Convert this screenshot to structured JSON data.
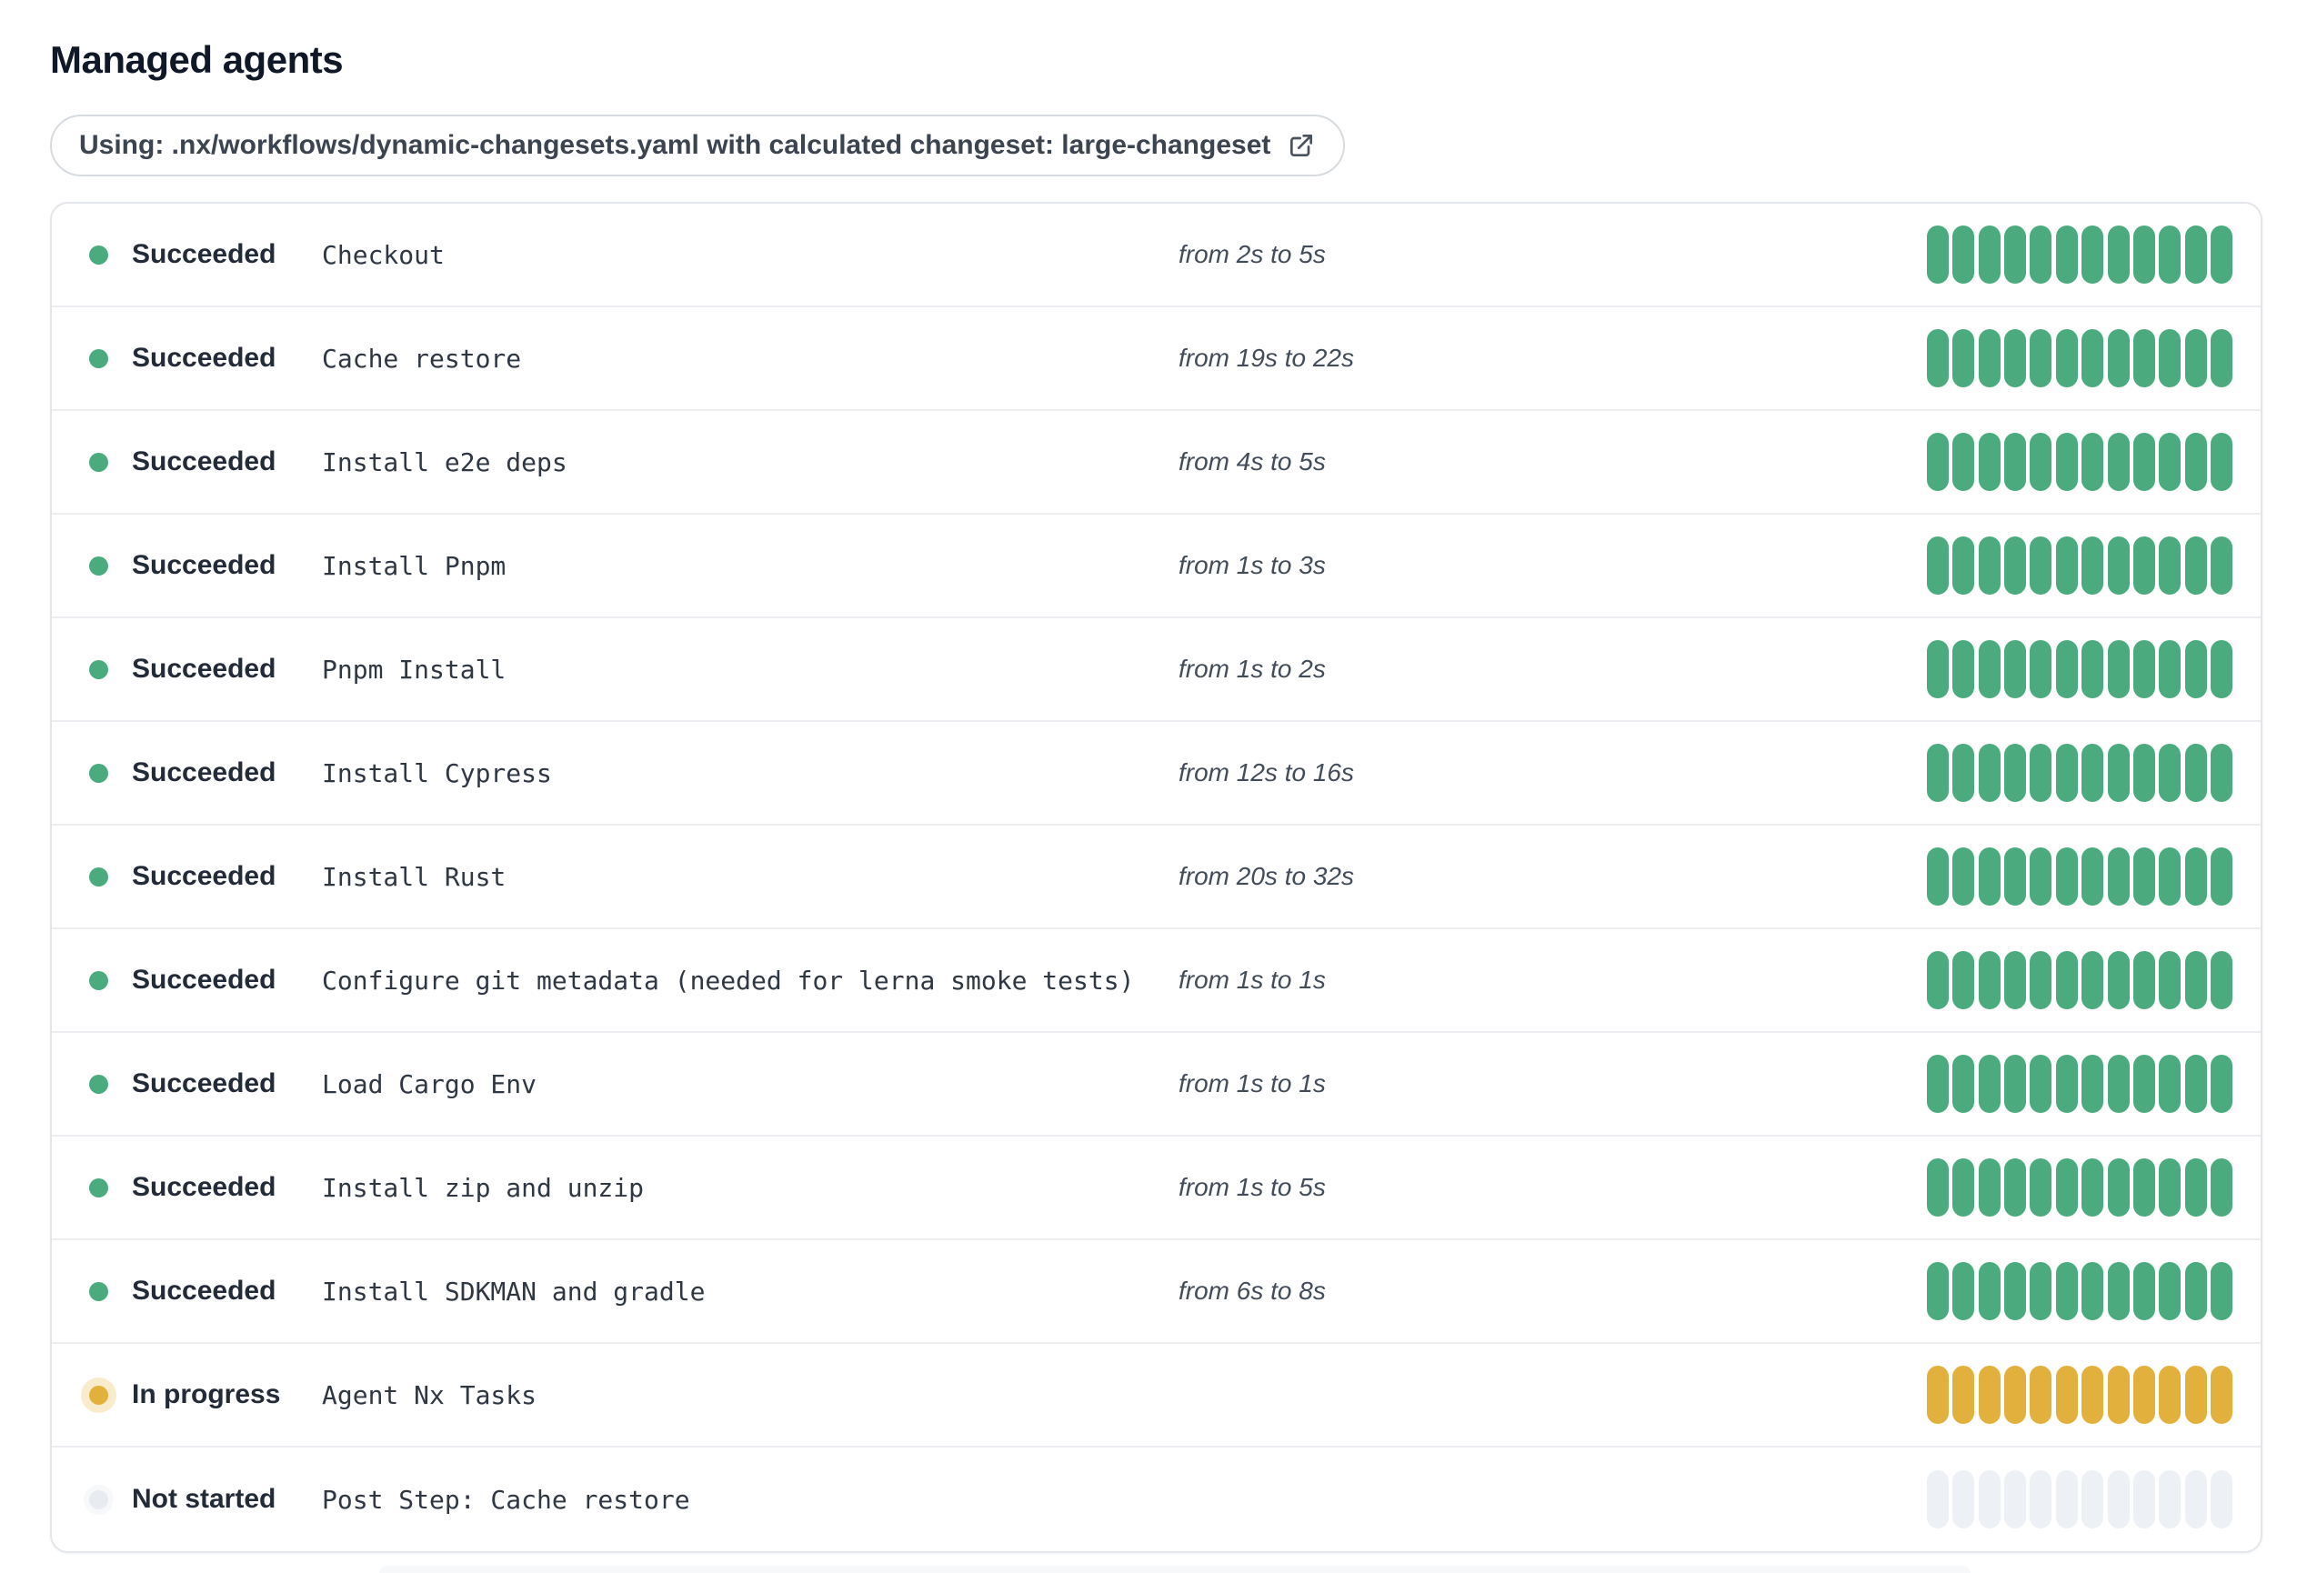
{
  "title": "Managed agents",
  "workflow_pill": {
    "text": "Using: .nx/workflows/dynamic-changesets.yaml with calculated changeset: large-changeset",
    "icon": "external-link-icon"
  },
  "agents_table": {
    "segments_per_row": 12,
    "rows": [
      {
        "status": "succeeded",
        "status_label": "Succeeded",
        "name": "Checkout",
        "duration": "from 2s to 5s"
      },
      {
        "status": "succeeded",
        "status_label": "Succeeded",
        "name": "Cache restore",
        "duration": "from 19s to 22s"
      },
      {
        "status": "succeeded",
        "status_label": "Succeeded",
        "name": "Install e2e deps",
        "duration": "from 4s to 5s"
      },
      {
        "status": "succeeded",
        "status_label": "Succeeded",
        "name": "Install Pnpm",
        "duration": "from 1s to 3s"
      },
      {
        "status": "succeeded",
        "status_label": "Succeeded",
        "name": "Pnpm Install",
        "duration": "from 1s to 2s"
      },
      {
        "status": "succeeded",
        "status_label": "Succeeded",
        "name": "Install Cypress",
        "duration": "from 12s to 16s"
      },
      {
        "status": "succeeded",
        "status_label": "Succeeded",
        "name": "Install Rust",
        "duration": "from 20s to 32s"
      },
      {
        "status": "succeeded",
        "status_label": "Succeeded",
        "name": "Configure git metadata (needed for lerna smoke tests)",
        "duration": "from 1s to 1s"
      },
      {
        "status": "succeeded",
        "status_label": "Succeeded",
        "name": "Load Cargo Env",
        "duration": "from 1s to 1s"
      },
      {
        "status": "succeeded",
        "status_label": "Succeeded",
        "name": "Install zip and unzip",
        "duration": "from 1s to 5s"
      },
      {
        "status": "succeeded",
        "status_label": "Succeeded",
        "name": "Install SDKMAN and gradle",
        "duration": "from 6s to 8s"
      },
      {
        "status": "in-progress",
        "status_label": "In progress",
        "name": "Agent Nx Tasks",
        "duration": ""
      },
      {
        "status": "not-started",
        "status_label": "Not started",
        "name": "Post Step: Cache restore",
        "duration": ""
      }
    ]
  },
  "colors": {
    "succeeded": "#4BAB7F",
    "in_progress": "#E2B13D",
    "not_started_segment": "#EDF1F5",
    "not_started_dot": "#E8ECF0",
    "row_divider": "#ECEEF1",
    "card_border": "#E3E6EA",
    "pill_border": "#D7DBE0",
    "title_text": "#101828",
    "status_text": "#232B38",
    "step_text": "#2F3742",
    "duration_text": "#434C59",
    "pill_text": "#3C4450"
  }
}
